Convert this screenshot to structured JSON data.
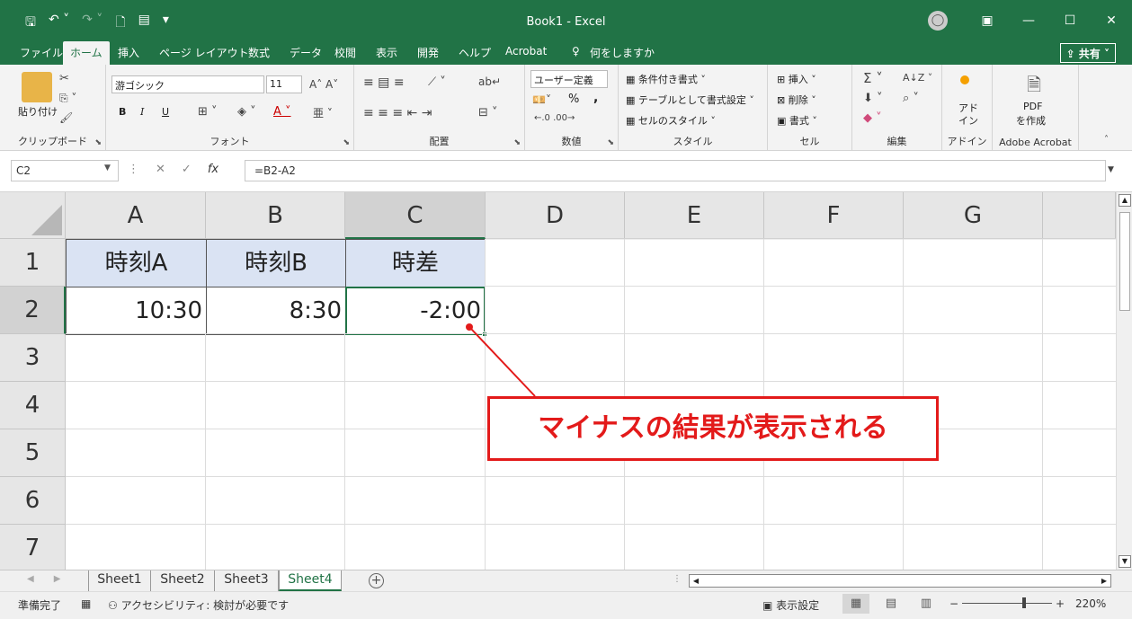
{
  "window": {
    "title": "Book1  -  Excel",
    "controls": [
      "ribbon-display",
      "minimize",
      "maximize",
      "close"
    ]
  },
  "menu": {
    "tabs": [
      "ファイル",
      "ホーム",
      "挿入",
      "ページ レイアウト",
      "数式",
      "データ",
      "校閲",
      "表示",
      "開発",
      "ヘルプ",
      "Acrobat"
    ],
    "active_tab": "ホーム",
    "search": "何をしますか",
    "share": "共有"
  },
  "ribbon": {
    "clipboard": {
      "label": "クリップボード",
      "paste": "貼り付け"
    },
    "font": {
      "label": "フォント",
      "name": "游ゴシック",
      "size": "11",
      "bold": "B",
      "italic": "I",
      "underline": "U"
    },
    "alignment": {
      "label": "配置"
    },
    "number": {
      "label": "数値",
      "format": "ユーザー定義",
      "percent": "%",
      "comma": ","
    },
    "styles": {
      "label": "スタイル",
      "conditional": "条件付き書式",
      "table": "テーブルとして書式設定",
      "cell_styles": "セルのスタイル"
    },
    "cells": {
      "label": "セル",
      "insert": "挿入",
      "delete": "削除",
      "format": "書式"
    },
    "editing": {
      "label": "編集"
    },
    "addins": {
      "label": "アドイン",
      "addins_btn_line1": "アド",
      "addins_btn_line2": "イン"
    },
    "acrobat": {
      "label": "Adobe Acrobat",
      "pdf_line1": "PDF",
      "pdf_line2": "を作成"
    }
  },
  "formula_bar": {
    "name_box": "C2",
    "formula": "=B2-A2"
  },
  "grid": {
    "columns": [
      "A",
      "B",
      "C",
      "D",
      "E",
      "F",
      "G"
    ],
    "rows": [
      "1",
      "2",
      "3",
      "4",
      "5",
      "6",
      "7"
    ],
    "selected_column": "C",
    "selected_row": "2",
    "cells": {
      "A1": "時刻A",
      "B1": "時刻B",
      "C1": "時差",
      "A2": "10:30",
      "B2": "8:30",
      "C2": "-2:00"
    }
  },
  "callout": {
    "text": "マイナスの結果が表示される",
    "color": "#e31a1a"
  },
  "sheets": {
    "tabs": [
      "Sheet1",
      "Sheet2",
      "Sheet3",
      "Sheet4"
    ],
    "active": "Sheet4"
  },
  "status": {
    "ready": "準備完了",
    "accessibility": "アクセシビリティ: 検討が必要です",
    "display_settings": "表示設定",
    "zoom": "220%"
  },
  "colors": {
    "excel_green": "#217346",
    "header_fill": "#dae3f3"
  }
}
